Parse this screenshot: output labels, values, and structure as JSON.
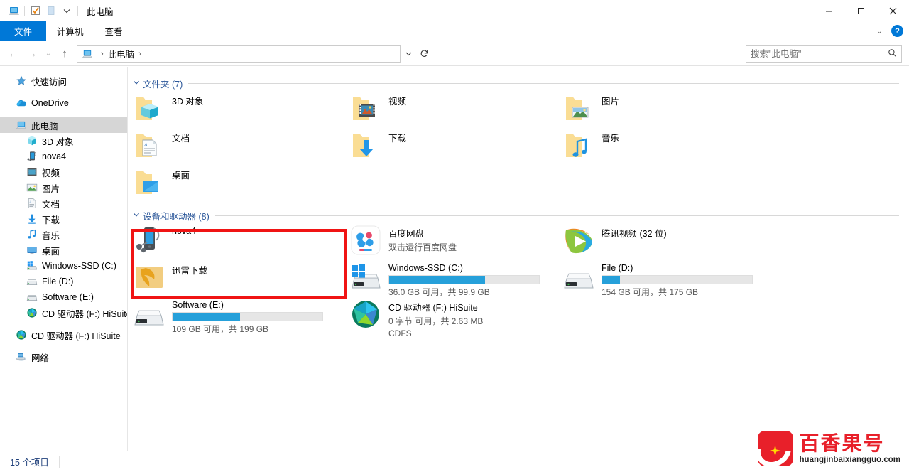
{
  "window": {
    "title": "此电脑",
    "quick_access_icons": [
      "this-pc-icon",
      "properties-icon",
      "new-folder-icon",
      "customize-qat-dropdown"
    ],
    "controls": {
      "minimize": "—",
      "maximize": "☐",
      "close": "✕"
    }
  },
  "ribbon": {
    "tabs": [
      {
        "label": "文件",
        "active": true
      },
      {
        "label": "计算机",
        "active": false
      },
      {
        "label": "查看",
        "active": false
      }
    ],
    "collapse_chevron": "⌄",
    "help_label": "?"
  },
  "address_bar": {
    "back": "←",
    "forward": "→",
    "recent": "⌄",
    "up": "↑",
    "crumbs": [
      "此电脑"
    ],
    "crumb_separator": "›",
    "history_dropdown": "⌄",
    "refresh": "↻"
  },
  "search": {
    "placeholder": "搜索\"此电脑\"",
    "value": "",
    "icon": "search-icon"
  },
  "sidebar": {
    "items": [
      {
        "label": "快速访问",
        "icon": "pin-star-icon",
        "level": 0,
        "selected": false,
        "gap_before": true
      },
      {
        "label": "OneDrive",
        "icon": "onedrive-cloud-icon",
        "level": 0,
        "selected": false,
        "gap_before": true
      },
      {
        "label": "此电脑",
        "icon": "this-pc-icon",
        "level": 0,
        "selected": true,
        "gap_before": true
      },
      {
        "label": "3D 对象",
        "icon": "3d-objects-icon",
        "level": 1,
        "selected": false,
        "gap_before": false
      },
      {
        "label": "nova4",
        "icon": "phone-device-icon",
        "level": 1,
        "selected": false,
        "gap_before": false
      },
      {
        "label": "视频",
        "icon": "videos-icon",
        "level": 1,
        "selected": false,
        "gap_before": false
      },
      {
        "label": "图片",
        "icon": "pictures-icon",
        "level": 1,
        "selected": false,
        "gap_before": false
      },
      {
        "label": "文档",
        "icon": "documents-icon",
        "level": 1,
        "selected": false,
        "gap_before": false
      },
      {
        "label": "下载",
        "icon": "downloads-icon",
        "level": 1,
        "selected": false,
        "gap_before": false
      },
      {
        "label": "音乐",
        "icon": "music-icon",
        "level": 1,
        "selected": false,
        "gap_before": false
      },
      {
        "label": "桌面",
        "icon": "desktop-icon",
        "level": 1,
        "selected": false,
        "gap_before": false
      },
      {
        "label": "Windows-SSD (C:)",
        "icon": "windows-drive-icon",
        "level": 1,
        "selected": false,
        "gap_before": false
      },
      {
        "label": "File (D:)",
        "icon": "hdd-icon",
        "level": 1,
        "selected": false,
        "gap_before": false
      },
      {
        "label": "Software (E:)",
        "icon": "hdd-icon",
        "level": 1,
        "selected": false,
        "gap_before": false
      },
      {
        "label": "CD 驱动器 (F:) HiSuite",
        "icon": "cd-drive-icon",
        "level": 1,
        "selected": false,
        "gap_before": false
      },
      {
        "label": "CD 驱动器 (F:) HiSuite",
        "icon": "cd-drive-icon",
        "level": 0,
        "selected": false,
        "gap_before": true
      },
      {
        "label": "网络",
        "icon": "network-icon",
        "level": 0,
        "selected": false,
        "gap_before": true
      }
    ]
  },
  "content": {
    "groups": [
      {
        "title": "文件夹 (7)",
        "chevron": "⌄",
        "items": [
          {
            "name": "3D 对象",
            "icon": "folder-3d-objects-icon",
            "col": 0,
            "row": 0
          },
          {
            "name": "视频",
            "icon": "folder-videos-icon",
            "col": 1,
            "row": 0
          },
          {
            "name": "图片",
            "icon": "folder-pictures-icon",
            "col": 2,
            "row": 0
          },
          {
            "name": "文档",
            "icon": "folder-documents-icon",
            "col": 0,
            "row": 1
          },
          {
            "name": "下载",
            "icon": "folder-downloads-icon",
            "col": 1,
            "row": 1
          },
          {
            "name": "音乐",
            "icon": "folder-music-icon",
            "col": 2,
            "row": 1
          },
          {
            "name": "桌面",
            "icon": "folder-desktop-icon",
            "col": 0,
            "row": 2
          }
        ]
      },
      {
        "title": "设备和驱动器 (8)",
        "chevron": "⌄",
        "items": [
          {
            "name": "nova4",
            "icon": "phone-device-icon",
            "col": 0,
            "row": 0,
            "subtitle": "",
            "bar": null
          },
          {
            "name": "百度网盘",
            "icon": "baidu-netdisk-icon",
            "col": 1,
            "row": 0,
            "subtitle": "双击运行百度网盘",
            "bar": null
          },
          {
            "name": "腾讯视频 (32 位)",
            "icon": "tencent-video-icon",
            "col": 2,
            "row": 0,
            "subtitle": "",
            "bar": null
          },
          {
            "name": "迅雷下载",
            "icon": "thunder-download-folder-icon",
            "col": 0,
            "row": 1,
            "subtitle": "",
            "bar": null
          },
          {
            "name": "Windows-SSD (C:)",
            "icon": "windows-drive-icon",
            "col": 1,
            "row": 1,
            "subtitle": "36.0 GB 可用，共 99.9 GB",
            "bar": {
              "percent": 64,
              "color": "#26a0da"
            }
          },
          {
            "name": "File (D:)",
            "icon": "hdd-icon",
            "col": 2,
            "row": 1,
            "subtitle": "154 GB 可用，共 175 GB",
            "bar": {
              "percent": 12,
              "color": "#26a0da"
            }
          },
          {
            "name": "Software (E:)",
            "icon": "hdd-icon",
            "col": 0,
            "row": 2,
            "subtitle": "109 GB 可用，共 199 GB",
            "bar": {
              "percent": 45,
              "color": "#26a0da"
            }
          },
          {
            "name": "CD 驱动器 (F:) HiSuite",
            "icon": "cd-drive-icon",
            "col": 1,
            "row": 2,
            "subtitle": "0 字节 可用，共 2.63 MB",
            "subtitle2": "CDFS",
            "bar": null
          }
        ]
      }
    ]
  },
  "status_bar": {
    "item_count": "15 个项目"
  },
  "annotation": {
    "type": "red-rectangle",
    "color": "#f01414",
    "target": "nova4"
  },
  "watermark": {
    "title": "百香果号",
    "url": "huangjinbaixiangguo.com",
    "color": "#e8202a"
  }
}
